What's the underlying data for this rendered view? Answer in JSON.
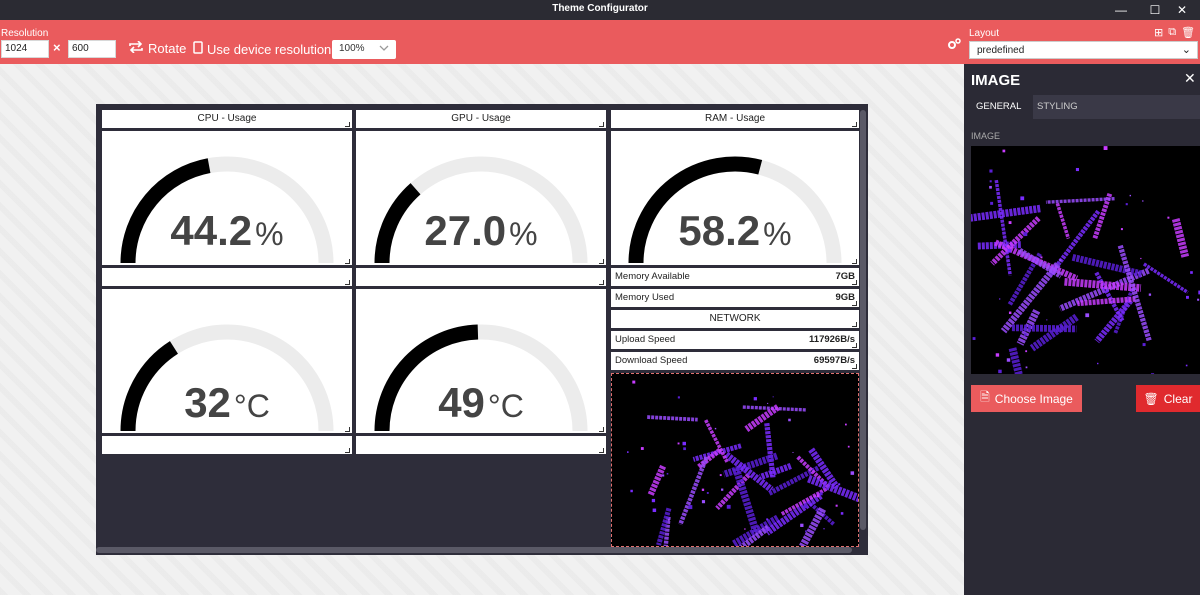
{
  "window": {
    "title": "Theme Configurator"
  },
  "toolbar": {
    "resolution_label": "Resolution",
    "width": "1024",
    "height": "600",
    "times": "×",
    "rotate_label": "Rotate",
    "device_resolution_label": "Use device resolution",
    "zoom": "100%",
    "layout_label": "Layout",
    "layout_value": "predefined"
  },
  "widgets": {
    "cpu_header": "CPU - Usage",
    "gpu_header": "GPU - Usage",
    "ram_header": "RAM - Usage",
    "cpu_usage": {
      "value": "44.2",
      "unit": "%",
      "fraction": 0.442
    },
    "gpu_usage": {
      "value": "27.0",
      "unit": "%",
      "fraction": 0.27
    },
    "ram_usage": {
      "value": "58.2",
      "unit": "%",
      "fraction": 0.582
    },
    "cpu_temp": {
      "value": "32",
      "unit": "°C",
      "fraction": 0.32
    },
    "gpu_temp": {
      "value": "49",
      "unit": "°C",
      "fraction": 0.49
    },
    "memory_available_label": "Memory Available",
    "memory_available_value": "7GB",
    "memory_used_label": "Memory Used",
    "memory_used_value": "9GB",
    "network_header": "NETWORK",
    "upload_label": "Upload Speed",
    "upload_value": "117926B/s",
    "download_label": "Download Speed",
    "download_value": "69597B/s"
  },
  "panel": {
    "title": "IMAGE",
    "tab_general": "GENERAL",
    "tab_styling": "STYLING",
    "image_label": "IMAGE",
    "choose_label": "Choose Image",
    "clear_label": "Clear"
  },
  "colors": {
    "accent": "#ea5b5d",
    "danger": "#e02a2e",
    "gauge_fill": "#000000",
    "gauge_track": "#ececec",
    "art_purple": "#7a2cff",
    "art_magenta": "#c83cff"
  }
}
